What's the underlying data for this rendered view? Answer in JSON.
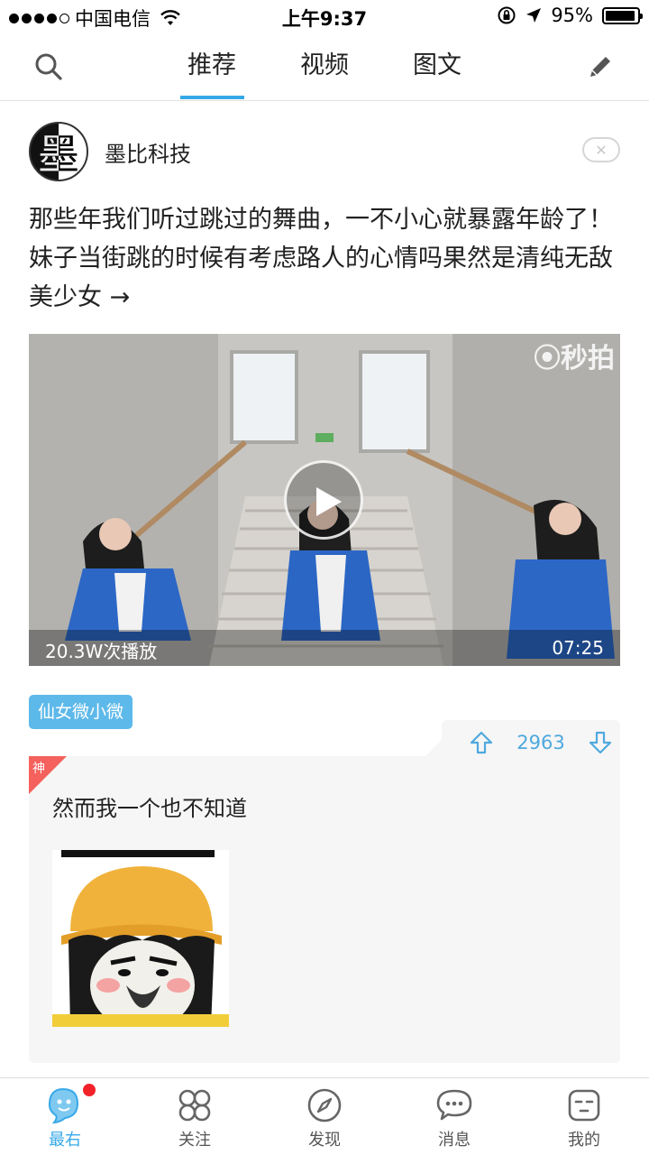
{
  "status_bar": {
    "carrier": "中国电信",
    "time": "上午9:37",
    "battery_percent": "95%",
    "battery_level": 0.95
  },
  "top_nav": {
    "tabs": [
      {
        "label": "推荐",
        "active": true
      },
      {
        "label": "视频",
        "active": false
      },
      {
        "label": "图文",
        "active": false
      }
    ],
    "icons": {
      "left": "search-icon",
      "right": "pencil-icon"
    }
  },
  "post": {
    "author_name": "墨比科技",
    "avatar_char": "墨",
    "title": "那些年我们听过跳过的舞曲，一不小心就暴露年龄了！妹子当街跳的时候有考虑路人的心情吗果然是清纯无敌美少女 →",
    "video": {
      "watermark": "⦿秒拍",
      "play_count": "20.3W次播放",
      "duration": "07:25"
    },
    "tag": "仙女微小微"
  },
  "comment": {
    "badge": "神",
    "votes": "2963",
    "text": "然而我一个也不知道"
  },
  "bottom_tabs": [
    {
      "label": "最右",
      "icon": "zuiyou-logo-icon",
      "active": true,
      "has_dot": true
    },
    {
      "label": "关注",
      "icon": "grid-icon",
      "active": false
    },
    {
      "label": "发现",
      "icon": "compass-icon",
      "active": false
    },
    {
      "label": "消息",
      "icon": "chat-bubble-icon",
      "active": false
    },
    {
      "label": "我的",
      "icon": "face-icon",
      "active": false
    }
  ],
  "colors": {
    "accent": "#37a9e8",
    "tag_bg": "#5db9ea",
    "badge": "#f5615c",
    "notify_dot": "#f2222a"
  }
}
